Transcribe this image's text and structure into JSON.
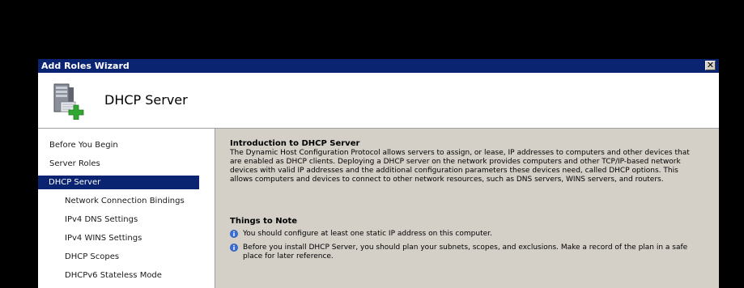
{
  "window": {
    "title": "Add Roles Wizard",
    "close_glyph": "✕"
  },
  "header": {
    "title": "DHCP Server",
    "icon": "server-add-icon"
  },
  "nav": {
    "items": [
      {
        "label": "Before You Begin",
        "selected": false
      },
      {
        "label": "Server Roles",
        "selected": false
      },
      {
        "label": "DHCP Server",
        "selected": true
      },
      {
        "label": "Network Connection Bindings",
        "selected": false
      },
      {
        "label": "IPv4 DNS Settings",
        "selected": false
      },
      {
        "label": "IPv4 WINS Settings",
        "selected": false
      },
      {
        "label": "DHCP Scopes",
        "selected": false
      },
      {
        "label": "DHCPv6 Stateless Mode",
        "selected": false
      }
    ]
  },
  "content": {
    "intro_heading": "Introduction to DHCP Server",
    "intro_body": "The Dynamic Host Configuration Protocol allows servers to assign, or lease, IP addresses to computers and other devices that are enabled as DHCP clients. Deploying a DHCP server on the network provides computers and other TCP/IP-based network devices with valid IP addresses and the additional configuration parameters these devices need, called DHCP options. This allows computers and devices to connect to other network resources, such as DNS servers, WINS servers, and routers.",
    "things_heading": "Things to Note",
    "notes": [
      {
        "icon": "info-icon",
        "text": "You should configure at least one static IP address on this computer."
      },
      {
        "icon": "info-icon",
        "text": "Before you install DHCP Server, you should plan your subnets, scopes, and exclusions. Make a record of the plan in a safe place for later reference."
      }
    ]
  },
  "colors": {
    "titlebar": "#0a2472",
    "selection": "#0a2472",
    "content_bg": "#d4d0c8",
    "desktop": "#000000"
  }
}
